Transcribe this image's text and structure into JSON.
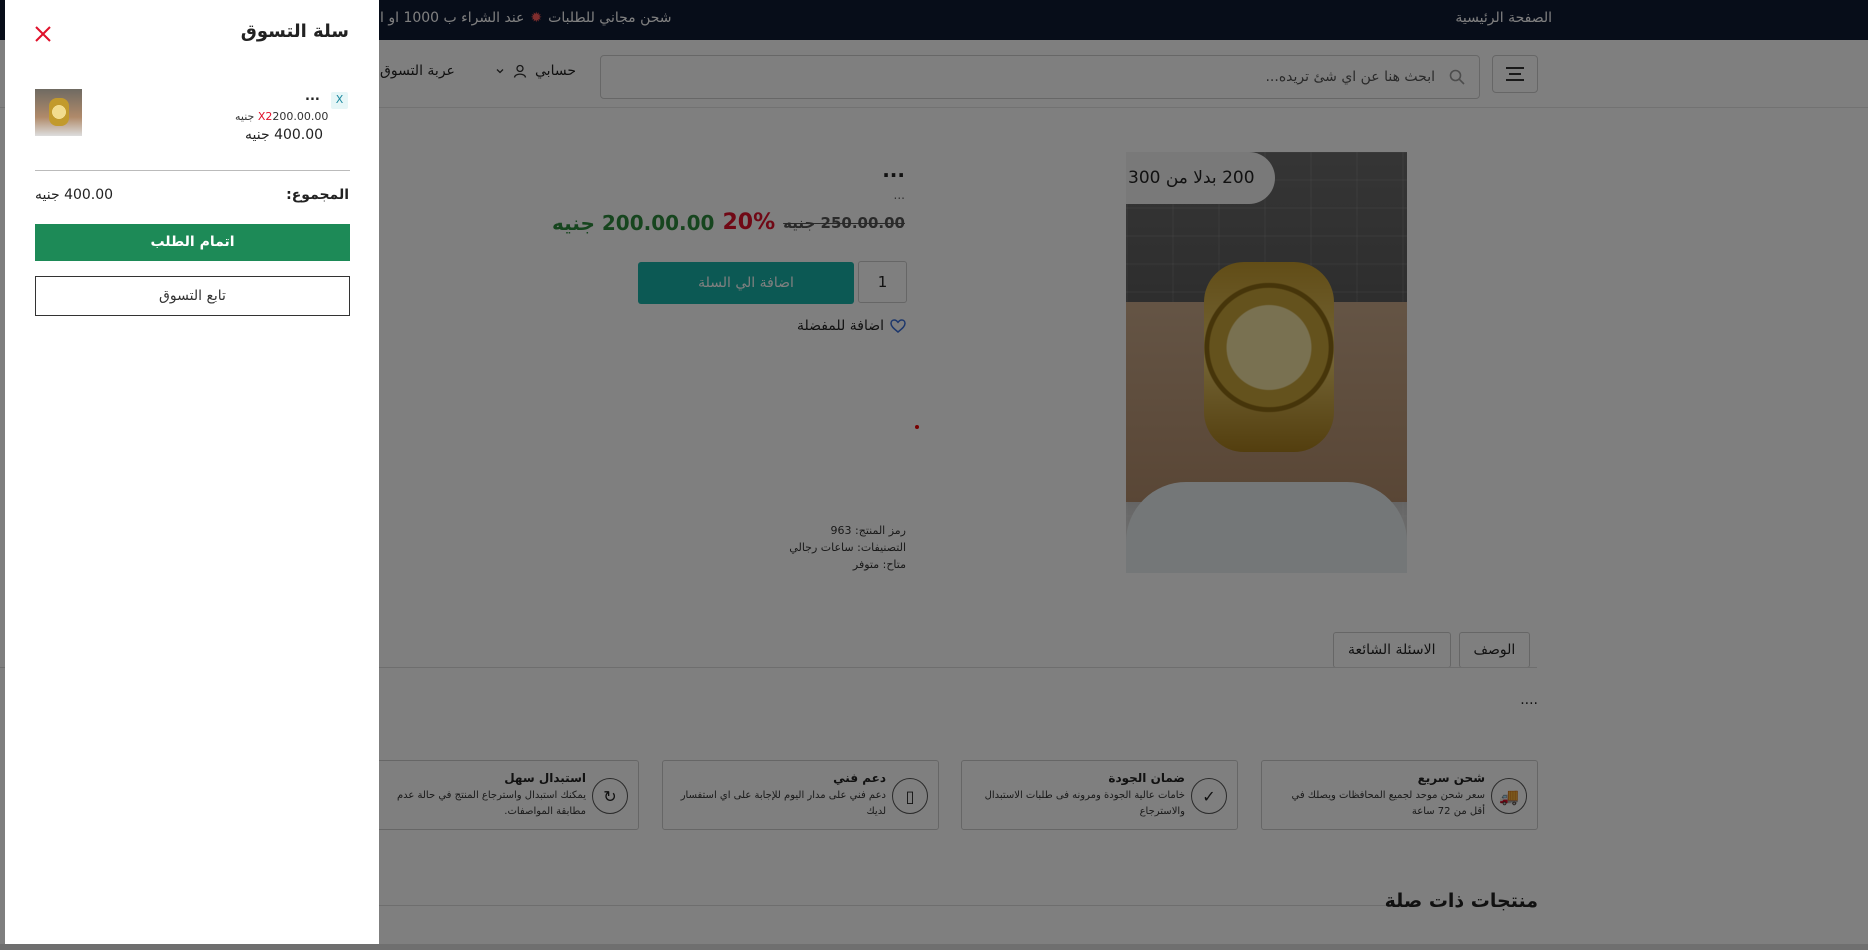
{
  "topbar": {
    "home_label": "الصفحة الرئيسية",
    "promo_text": "شحن مجاني للطلبات",
    "promo_text_2": "عند الشراء ب 1000 او ا"
  },
  "header": {
    "search_placeholder": "ابحث هنا عن اي شئ تريده...",
    "account_label": "حسابي",
    "cart_label": "عربة التسوق"
  },
  "product": {
    "badge": "200 بدلا من 300",
    "title": "...",
    "subtitle": "...",
    "old_price": "250.00.00 جنيه",
    "discount": "20%",
    "new_price": "200.00.00 جنيه",
    "quantity": "1",
    "add_to_cart": "اضافة الي السلة",
    "add_to_favorites": "اضافة للمفضلة",
    "sku": "رمز المنتج: 963",
    "category": "التصنيفات: ساعات رجالي",
    "availability": "متاح: متوفر"
  },
  "tabs": {
    "description": "الوصف",
    "faq": "الاسئلة الشائعة",
    "content": "...."
  },
  "features": [
    {
      "title": "شحن سريع",
      "text": "سعر شحن موحد لجميع المحافظات ويصلك في أقل من 72 ساعة",
      "icon": "truck-icon"
    },
    {
      "title": "ضمان الجودة",
      "text": "خامات عالية الجودة ومرونه فى طلبات الاستبدال والاسترجاع",
      "icon": "quality-badge-icon"
    },
    {
      "title": "دعم فني",
      "text": "دعم فني على مدار اليوم للإجابة على اي استفسار لديك",
      "icon": "phone-icon"
    },
    {
      "title": "استبدال سهل",
      "text": "يمكنك استبدال واسترجاع المنتج في حالة عدم مطابقة المواصفات.",
      "icon": "refresh-icon"
    }
  ],
  "related_title": "منتجات ذات صلة",
  "cart": {
    "title": "سلة التسوق",
    "item": {
      "name": "...",
      "remove": "X",
      "quantity": "X2",
      "unit_price": "200.00.00 جنيه",
      "total": "400.00 جنيه"
    },
    "sum_label": "المجموع:",
    "sum_value": "400.00 جنيه",
    "checkout_label": "اتمام الطلب",
    "continue_label": "تابع التسوق"
  },
  "colors": {
    "topbar": "#0f1a33",
    "add_to_cart": "#19b3a8",
    "checkout": "#1d8a57",
    "discount": "#e0112b",
    "new_price": "#2c8a3c"
  }
}
